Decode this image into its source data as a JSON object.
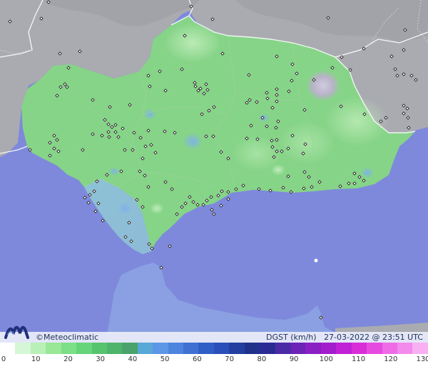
{
  "brand": {
    "name": "©Meteoclimatic",
    "logo_icon": "meteoclimatic-m-logo-icon"
  },
  "info": {
    "variable": "DGST (km/h)",
    "datetime": "27-03-2022 @ 23:51 UTC"
  },
  "legend": {
    "ticks": [
      "0",
      "10",
      "20",
      "30",
      "40",
      "50",
      "60",
      "70",
      "80",
      "90",
      "100",
      "110",
      "120",
      "130"
    ],
    "colors": [
      "#ffffff",
      "#d6f7d6",
      "#b8f0b8",
      "#98e898",
      "#7ddf88",
      "#66d47a",
      "#56c46e",
      "#4fb46b",
      "#4aa36c",
      "#58a8d8",
      "#5b97e6",
      "#4d84de",
      "#3f70d2",
      "#2f5fc6",
      "#2a4fb8",
      "#233f9f",
      "#1f318a",
      "#2a2a95",
      "#4b2aa6",
      "#6b24b6",
      "#8a20c4",
      "#a21dcc",
      "#c021d6",
      "#d82ed8",
      "#e64be0",
      "#ee6de6",
      "#f38bec",
      "#f8b0f2"
    ]
  },
  "colors": {
    "sea": "#7e89dc",
    "land_outside": "#a9abb0",
    "andalucia": "#86d488"
  },
  "stations_icon": "weather-station-marker-icon"
}
